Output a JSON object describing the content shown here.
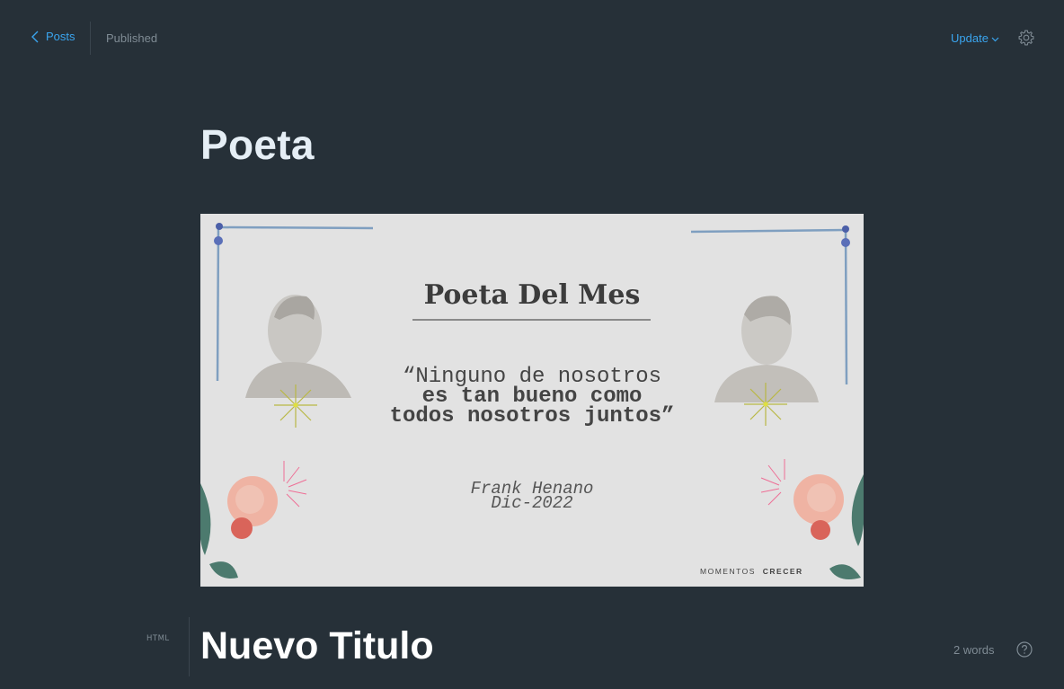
{
  "header": {
    "back_label": "Posts",
    "status": "Published",
    "update_label": "Update"
  },
  "post": {
    "title": "Poeta"
  },
  "feature_image": {
    "heading": "Poeta Del Mes",
    "quote_line1": "“Ninguno de nosotros",
    "quote_line2": "es tan bueno como",
    "quote_line3": "todos nosotros juntos”",
    "author": "Frank Henano",
    "date": "Dic-2022",
    "brand_light": "MOMENTOS",
    "brand_bold": "CRECER"
  },
  "editor": {
    "card_label": "HTML",
    "heading": "Nuevo Titulo",
    "word_count": "2 words"
  },
  "icons": {
    "back": "chevron-left-icon",
    "update": "chevron-down-icon",
    "settings": "gear-icon",
    "help": "question-circle-icon"
  },
  "colors": {
    "background": "#263038",
    "accent": "#3aa5ef",
    "muted": "#7f8b94",
    "title": "#e5eef5"
  }
}
